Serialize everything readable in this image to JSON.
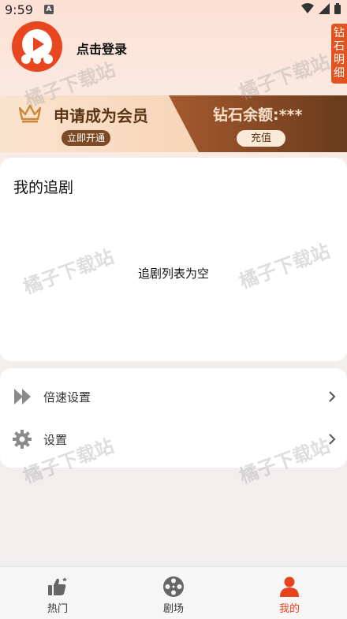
{
  "status_bar": {
    "time": "9:59",
    "notif_badge": "A"
  },
  "header": {
    "login_text": "点击登录",
    "diamond_detail": "钻石明细"
  },
  "vip_banner": {
    "title": "申请成为会员",
    "open_button": "立即开通",
    "balance": "钻石余额:***",
    "recharge_button": "充值"
  },
  "follow": {
    "title": "我的追剧",
    "empty_text": "追剧列表为空"
  },
  "settings": [
    {
      "label": "倍速设置",
      "icon": "speed-icon"
    },
    {
      "label": "设置",
      "icon": "gear-icon"
    }
  ],
  "watermark": "橘子下载站",
  "bottom_nav": [
    {
      "label": "热门",
      "icon": "thumbs-up-icon",
      "active": false
    },
    {
      "label": "剧场",
      "icon": "film-reel-icon",
      "active": false
    },
    {
      "label": "我的",
      "icon": "person-icon",
      "active": true
    }
  ],
  "colors": {
    "accent": "#e8431c",
    "vip_dark": "#6a3b1d"
  }
}
